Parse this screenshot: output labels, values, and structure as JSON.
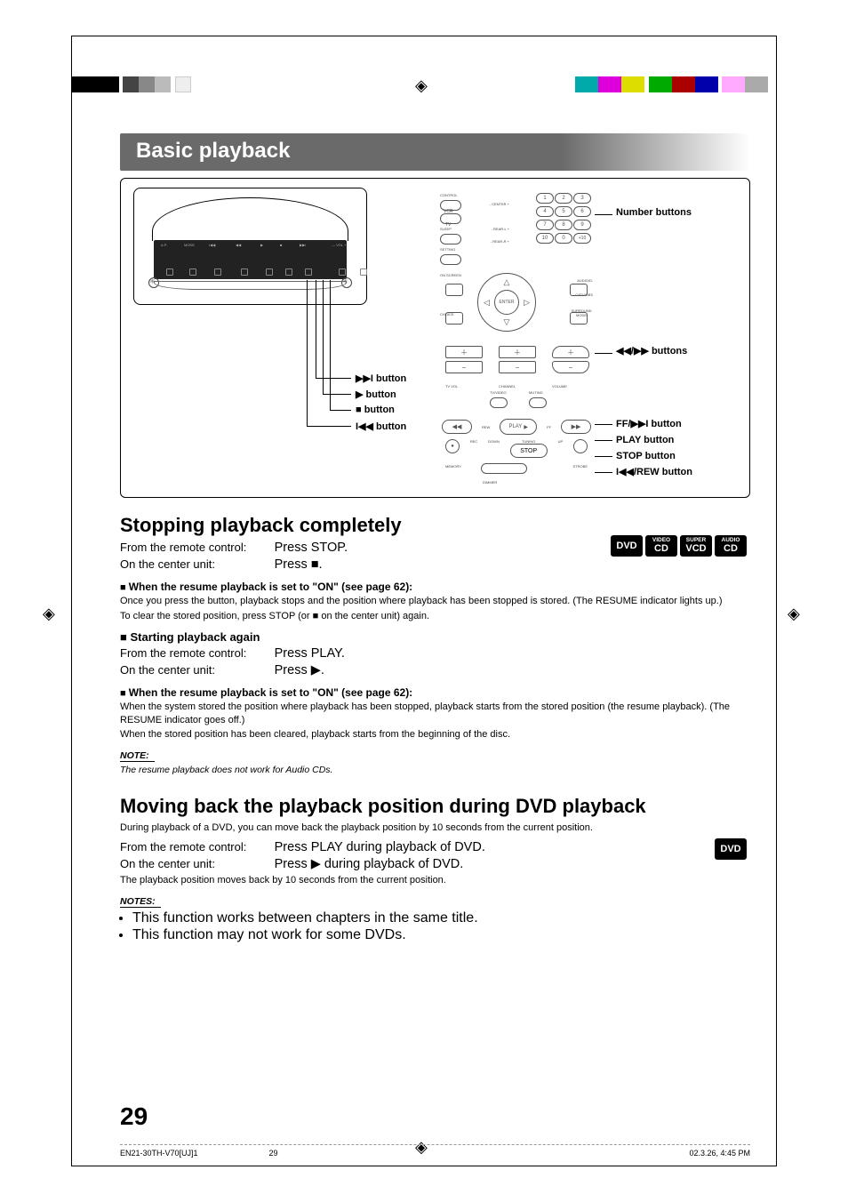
{
  "title_bar": "Basic playback",
  "diagram": {
    "device_callouts": {
      "btn1": "▶▶I button",
      "btn2": "▶ button",
      "btn3": "■ button",
      "btn4": "I◀◀ button"
    },
    "remote_tiny": {
      "control": "CONTROL",
      "vcr": "VCR",
      "tv": "TV",
      "sleep": "SLEEP",
      "setting": "SETTING",
      "on_screen": "ON SCREEN",
      "choice": "CHOICE",
      "enter": "ENTER",
      "audio_d": "AUDIO/D.",
      "catvdbs": "CATV/DBS",
      "surround": "SURROUND MODE",
      "tv_vol": "TV VOL",
      "channel": "CHANNEL",
      "volume": "VOLUME",
      "tvvideo": "TV/VIDEO",
      "muting": "MUTING",
      "rew": "REW",
      "play": "PLAY",
      "ff": "FF",
      "rec": "REC",
      "down": "DOWN",
      "tuning": "TUNING",
      "up": "UP",
      "memory": "MEMORY",
      "stop": "STOP",
      "strobe": "STROBE",
      "dimmer": "DIMMER",
      "center_minus": "- CENTER +",
      "rear_minus": "- REAR-L +",
      "rear_r": "- REAR-R +",
      "nums": [
        "1",
        "2",
        "3",
        "4",
        "5",
        "6",
        "7",
        "8",
        "9",
        "10",
        "0",
        "+10"
      ]
    },
    "right_labels": {
      "number_buttons": "Number buttons",
      "search_buttons": "◀◀/▶▶ buttons",
      "ff_button": "FF/▶▶I button",
      "play_button": "PLAY button",
      "stop_button": "STOP button",
      "rew_button": "I◀◀/REW button"
    }
  },
  "stopping": {
    "heading": "Stopping playback completely",
    "from_remote_label": "From the remote control:",
    "from_remote_action": "Press STOP.",
    "on_unit_label": "On the center unit:",
    "on_unit_action": "Press ■.",
    "sub1_title": "When the resume playback is set to \"ON\" (see page 62):",
    "sub1_body1": "Once you press the button, playback stops and the position where playback has been stopped is stored. (The RESUME indicator lights up.)",
    "sub1_body2": "To clear the stored position, press STOP (or ■ on the center unit) again.",
    "start_again": "Starting playback again",
    "from_remote_action2": "Press PLAY.",
    "on_unit_action2": "Press ▶.",
    "sub2_title": "When the resume playback is set to \"ON\" (see page 62):",
    "sub2_body1": "When the system stored the position where playback has been stopped, playback starts from the stored position (the resume playback). (The RESUME indicator goes off.)",
    "sub2_body2": "When the stored position has been cleared, playback starts from the beginning of the disc.",
    "note_hd": "NOTE:",
    "note_body": "The resume playback does not work for Audio CDs."
  },
  "moving": {
    "heading": "Moving back the playback position during DVD playback",
    "intro": "During playback of a DVD, you can move back the playback position by 10 seconds from the current position.",
    "from_remote_action": "Press PLAY during playback of DVD.",
    "on_unit_action": "Press ▶ during playback of DVD.",
    "result": "The playback position moves back by 10 seconds from the current position.",
    "notes_hd": "NOTES:",
    "note1": "This function works between chapters in the same title.",
    "note2": "This function may not work for some DVDs."
  },
  "badges": {
    "dvd": "DVD",
    "vcd_top": "VIDEO",
    "vcd": "CD",
    "svcd_top": "SUPER",
    "svcd": "VCD",
    "acd_top": "AUDIO",
    "acd": "CD"
  },
  "page_number": "29",
  "footer": {
    "file": "EN21-30TH-V70[UJ]1",
    "page": "29",
    "date": "02.3.26, 4:45 PM"
  }
}
